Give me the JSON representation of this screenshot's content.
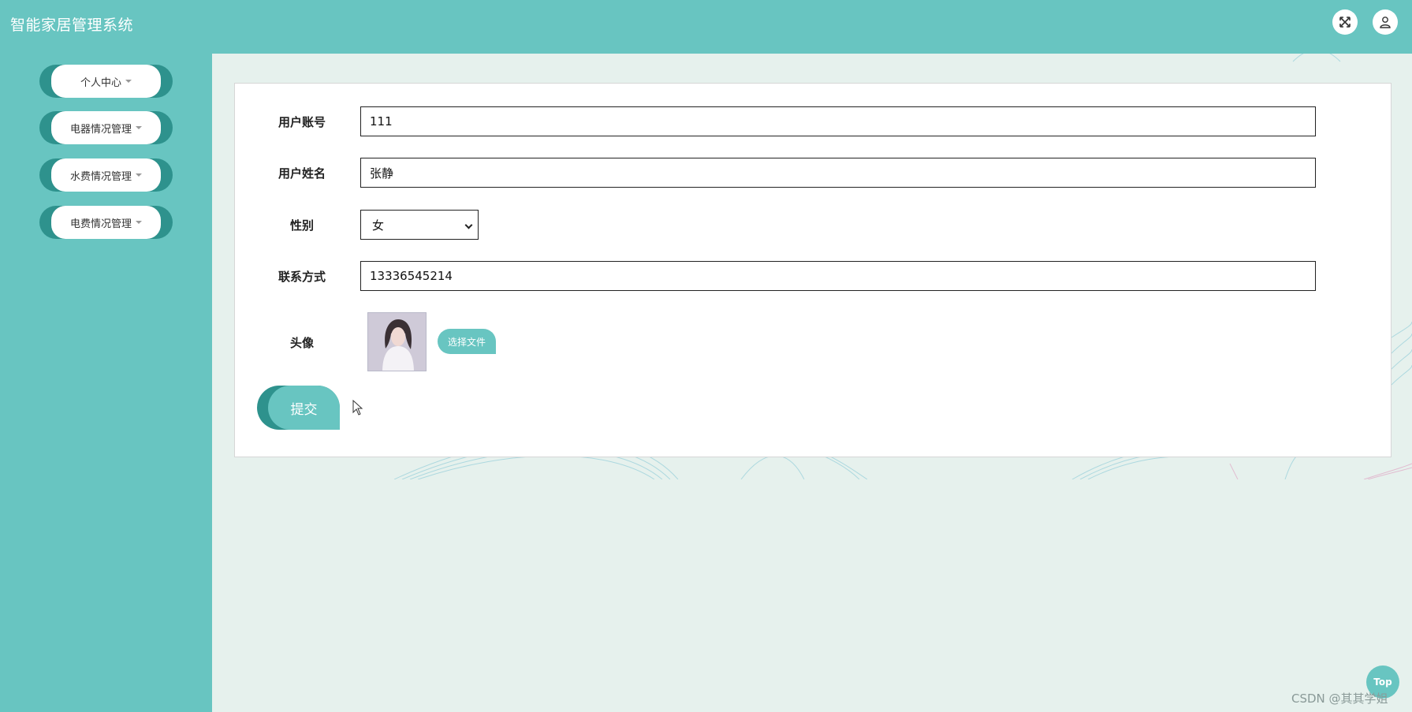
{
  "header": {
    "title": "智能家居管理系统",
    "fullscreen_icon": "expand-arrows-icon",
    "user_icon": "user-icon"
  },
  "sidebar": {
    "items": [
      {
        "label": "个人中心"
      },
      {
        "label": "电器情况管理"
      },
      {
        "label": "水费情况管理"
      },
      {
        "label": "电费情况管理"
      }
    ]
  },
  "form": {
    "account": {
      "label": "用户账号",
      "value": "111"
    },
    "name": {
      "label": "用户姓名",
      "value": "张静"
    },
    "gender": {
      "label": "性别",
      "value": "女"
    },
    "phone": {
      "label": "联系方式",
      "value": "13336545214"
    },
    "avatar": {
      "label": "头像",
      "choose_file_label": "选择文件"
    },
    "submit_label": "提交"
  },
  "footer": {
    "top_label": "Top",
    "watermark": "CSDN @其其学姐"
  },
  "colors": {
    "accent": "#68c5c1",
    "accent_dark": "#2e928d",
    "background": "#e6f1ed"
  }
}
